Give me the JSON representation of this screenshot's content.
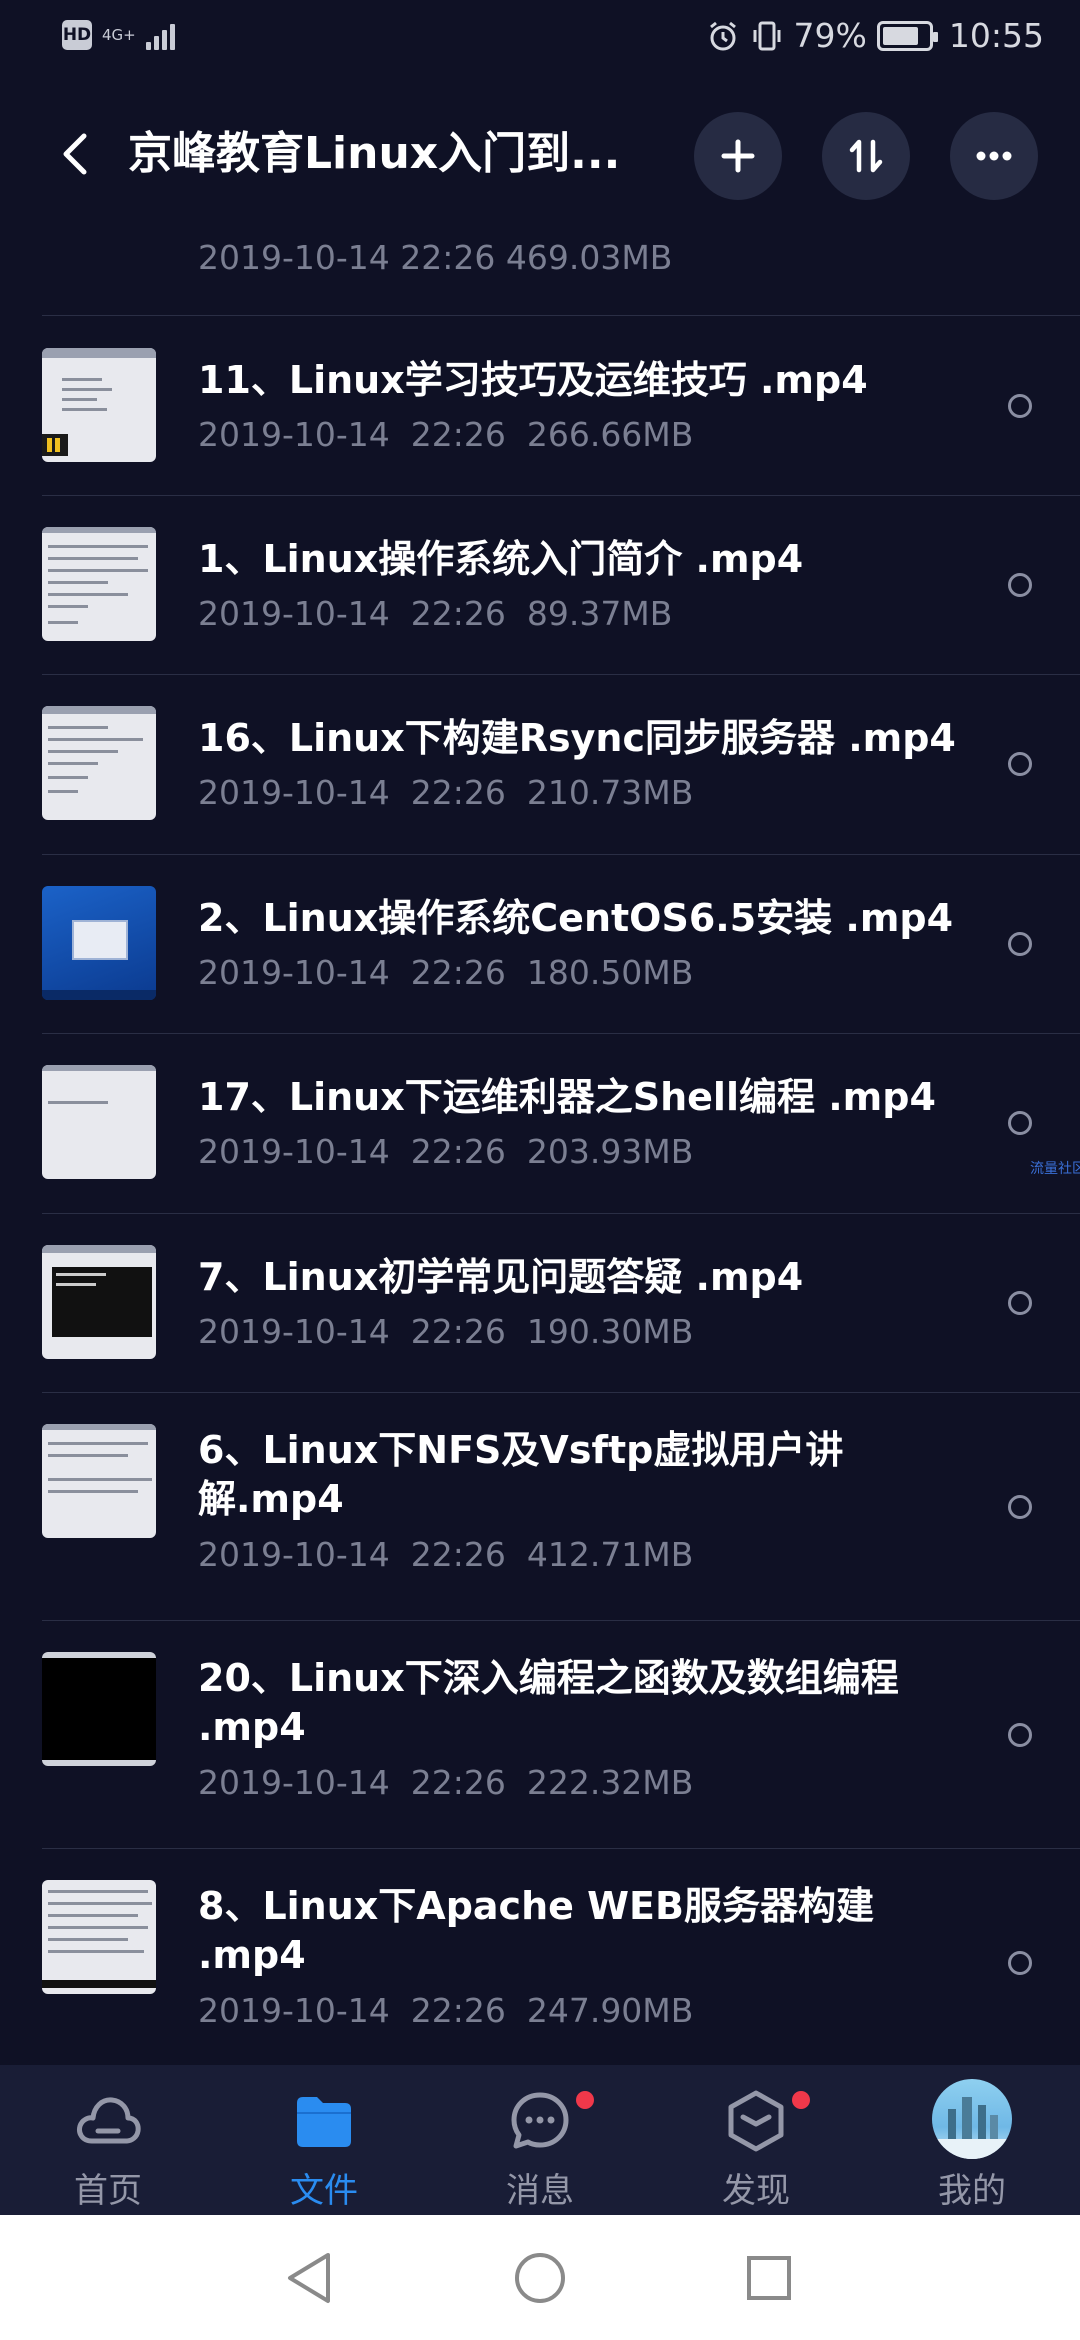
{
  "status_bar": {
    "hd_label": "HD",
    "network_label": "4G+",
    "battery_percent": "79%",
    "battery_level": 0.79,
    "time": "10:55"
  },
  "header": {
    "title": "京峰教育Linux入门到...",
    "icons": [
      "back-icon",
      "plus-icon",
      "sort-icon",
      "more-icon"
    ]
  },
  "partial_item": {
    "meta": "2019-10-14  22:26  469.03MB"
  },
  "files": [
    {
      "name": "11、Linux学习技巧及运维技巧 .mp4",
      "meta": "2019-10-14  22:26  266.66MB"
    },
    {
      "name": "1、Linux操作系统入门简介 .mp4",
      "meta": "2019-10-14  22:26  89.37MB"
    },
    {
      "name": "16、Linux下构建Rsync同步服务器 .mp4",
      "meta": "2019-10-14  22:26  210.73MB"
    },
    {
      "name": "2、Linux操作系统CentOS6.5安装 .mp4",
      "meta": "2019-10-14  22:26  180.50MB"
    },
    {
      "name": "17、Linux下运维利器之Shell编程 .mp4",
      "meta": "2019-10-14  22:26  203.93MB"
    },
    {
      "name": "7、Linux初学常见问题答疑 .mp4",
      "meta": "2019-10-14  22:26  190.30MB"
    },
    {
      "name": "6、Linux下NFS及Vsftp虚拟用户讲解.mp4",
      "meta": "2019-10-14  22:26  412.71MB"
    },
    {
      "name": "20、Linux下深入编程之函数及数组编程 .mp4",
      "meta": "2019-10-14  22:26  222.32MB"
    },
    {
      "name": "8、Linux下Apache WEB服务器构建 .mp4",
      "meta": "2019-10-14  22:26  247.90MB"
    }
  ],
  "watermark": "流量社区",
  "bottom_nav": [
    {
      "label": "首页",
      "icon": "cloud-icon",
      "active": false,
      "badge": false
    },
    {
      "label": "文件",
      "icon": "folder-icon",
      "active": true,
      "badge": false
    },
    {
      "label": "消息",
      "icon": "chat-icon",
      "active": false,
      "badge": true
    },
    {
      "label": "发现",
      "icon": "cube-icon",
      "active": false,
      "badge": true
    },
    {
      "label": "我的",
      "icon": "avatar",
      "active": false,
      "badge": false
    }
  ],
  "colors": {
    "background": "#0f1125",
    "accent": "#2a8cf0",
    "meta_text": "#7b7f92",
    "badge": "#f0384a"
  }
}
